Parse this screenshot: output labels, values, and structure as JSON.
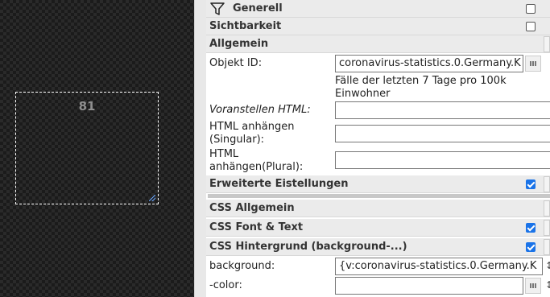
{
  "canvas": {
    "widget_value": "81"
  },
  "panel": {
    "generell": {
      "title": "Generell"
    },
    "sichtbarkeit": {
      "title": "Sichtbarkeit"
    },
    "allgemein": {
      "title": "Allgemein"
    },
    "objekt_id": {
      "label": "Objekt ID:",
      "value": "coronavirus-statistics.0.Germany.K"
    },
    "object_description": "Fälle der letzten 7 Tage pro 100k Einwohner",
    "prepend_html": {
      "label": "Voranstellen HTML:",
      "value": ""
    },
    "append_singular": {
      "label": "HTML anhängen (Singular):",
      "value": ""
    },
    "append_plural": {
      "label": "HTML anhängen(Plural):",
      "value": ""
    },
    "erweiterte": {
      "title": "Erweiterte Eistellungen",
      "checked": true
    },
    "css_allgemein": {
      "title": "CSS Allgemein"
    },
    "css_font": {
      "title": "CSS Font & Text",
      "checked": true
    },
    "css_bg": {
      "title": "CSS Hintergrund (background-...)",
      "checked": true
    },
    "background": {
      "label": "background:",
      "value": "{v:coronavirus-statistics.0.Germany.K"
    },
    "color": {
      "label": "-color:",
      "value": ""
    }
  },
  "colors": {
    "accent": "#1a73e8",
    "canvas_bg": "#1b1b1b",
    "group_bg": "#ebebeb"
  }
}
